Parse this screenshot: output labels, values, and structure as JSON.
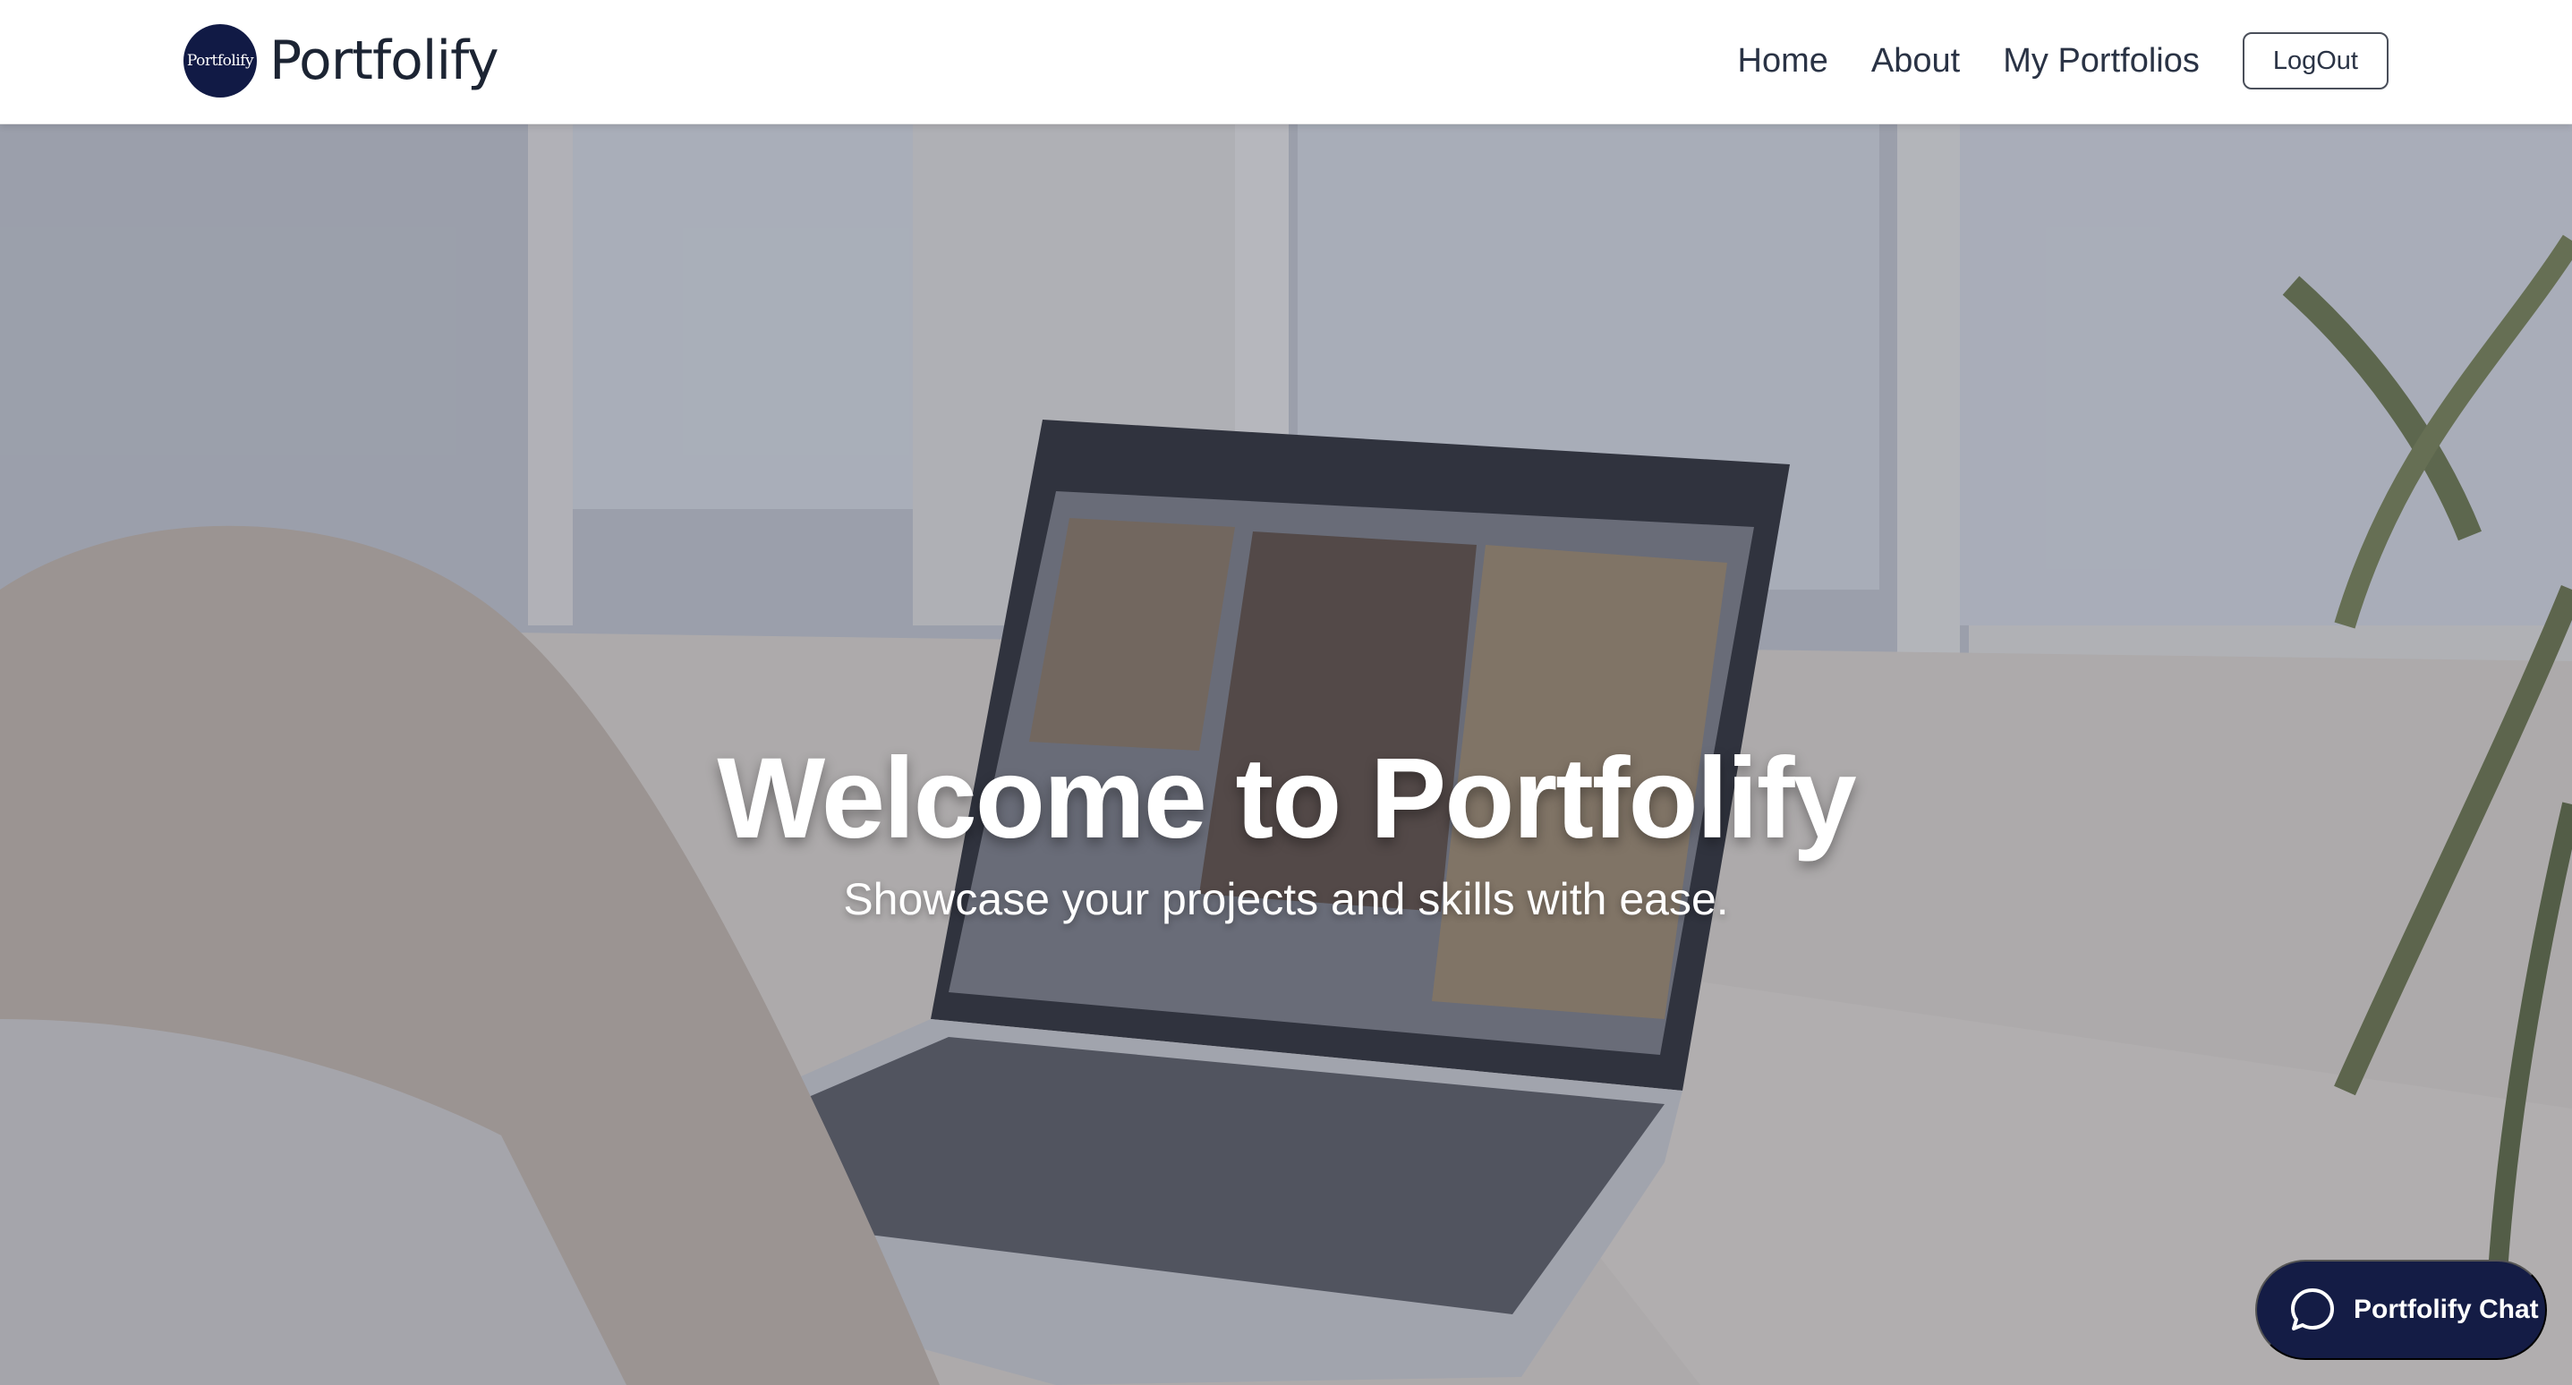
{
  "navbar": {
    "logo_text": "Portfolify",
    "brand_name": "Portfolify",
    "links": [
      {
        "label": "Home"
      },
      {
        "label": "About"
      },
      {
        "label": "My Portfolios"
      }
    ],
    "logout_label": "LogOut"
  },
  "hero": {
    "title": "Welcome to Portfolify",
    "subtitle": "Showcase your projects and skills with ease."
  },
  "chat": {
    "label": "Portfolify Chat",
    "icon": "chat-bubble-icon"
  },
  "colors": {
    "brand_navy": "#141c45",
    "nav_text": "#2a3345",
    "hero_overlay": "rgba(60,68,90,0.33)"
  }
}
